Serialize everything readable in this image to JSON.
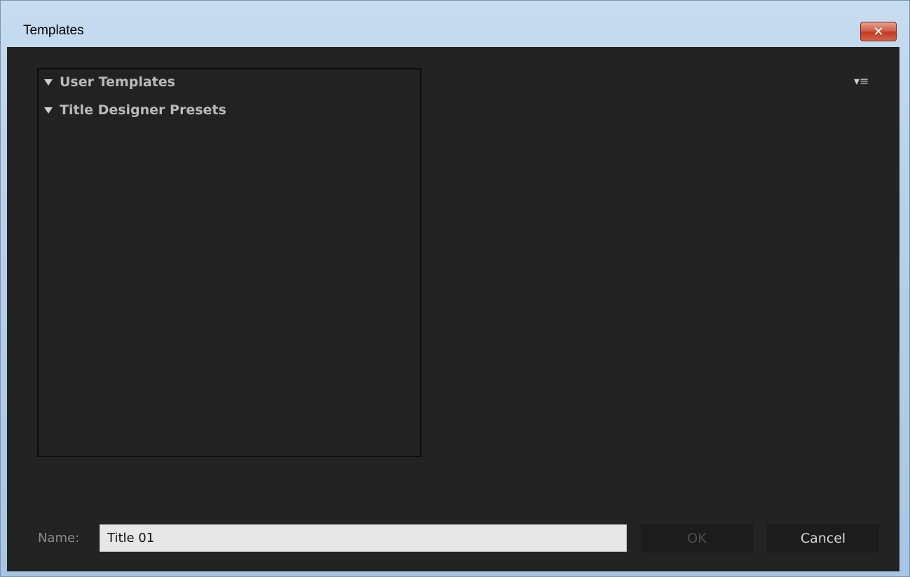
{
  "window": {
    "title": "Templates",
    "close_label": "✕"
  },
  "tree": {
    "items": [
      {
        "label": "User Templates",
        "expanded": true
      },
      {
        "label": "Title Designer Presets",
        "expanded": true
      }
    ]
  },
  "panel_menu": {
    "icon": "panel-menu-icon",
    "glyph": "▾≡"
  },
  "form": {
    "name_label": "Name:",
    "name_value": "Title 01"
  },
  "buttons": {
    "ok_label": "OK",
    "ok_enabled": false,
    "cancel_label": "Cancel"
  },
  "colors": {
    "client_bg": "#232323",
    "panel_bg": "#222222",
    "text_light": "#b9b9b9",
    "titlebar": "#b9d2ea",
    "close_btn": "#c23b22"
  }
}
